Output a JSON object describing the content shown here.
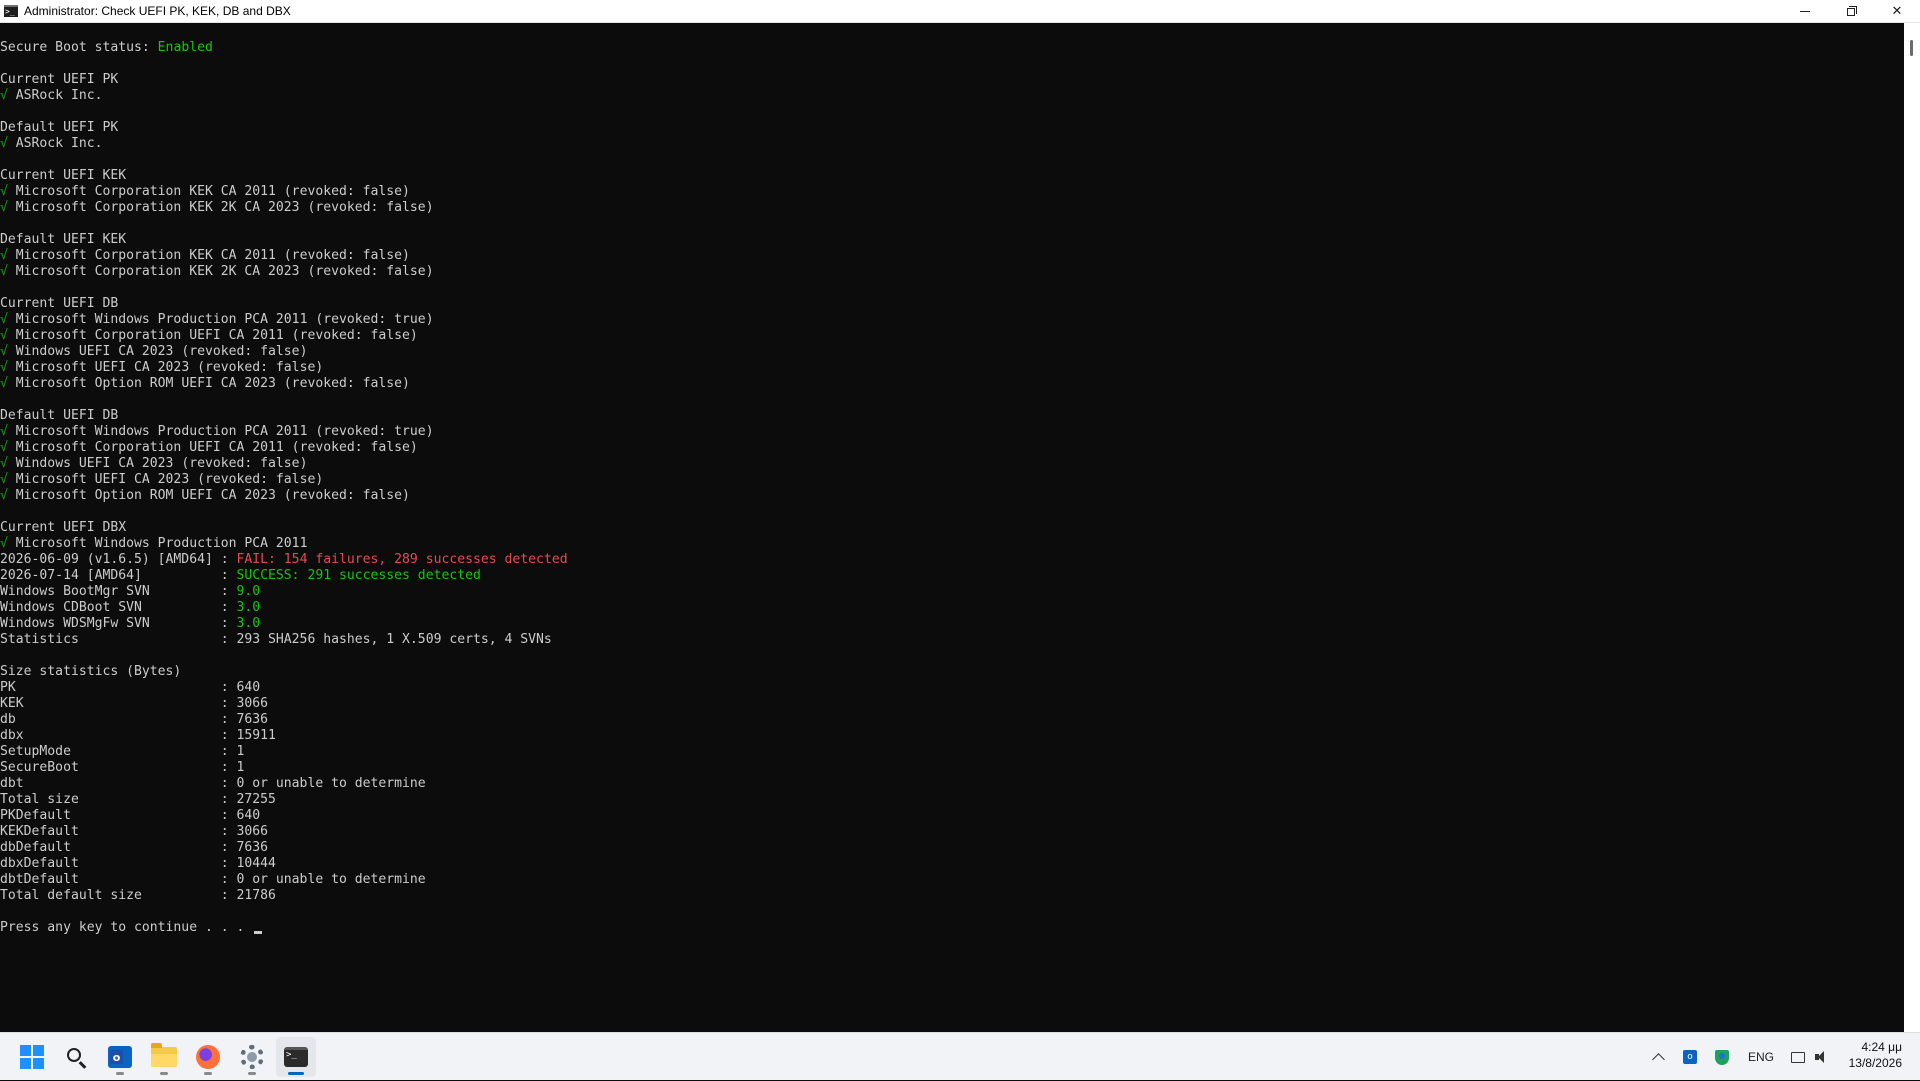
{
  "window": {
    "title": "Administrator:  Check UEFI PK, KEK, DB and DBX",
    "icon": "console-icon",
    "controls": {
      "minimize": "minimize-icon",
      "restore": "restore-icon",
      "close": "✕"
    }
  },
  "console": {
    "lines": [
      {
        "parts": [
          {
            "t": "Secure Boot status: ",
            "c": ""
          },
          {
            "t": "Enabled",
            "c": "ok"
          }
        ]
      },
      {
        "parts": []
      },
      {
        "parts": [
          {
            "t": "Current UEFI PK",
            "c": ""
          }
        ]
      },
      {
        "parts": [
          {
            "t": "√",
            "c": "check"
          },
          {
            "t": " ASRock Inc.",
            "c": ""
          }
        ]
      },
      {
        "parts": []
      },
      {
        "parts": [
          {
            "t": "Default UEFI PK",
            "c": ""
          }
        ]
      },
      {
        "parts": [
          {
            "t": "√",
            "c": "check"
          },
          {
            "t": " ASRock Inc.",
            "c": ""
          }
        ]
      },
      {
        "parts": []
      },
      {
        "parts": [
          {
            "t": "Current UEFI KEK",
            "c": ""
          }
        ]
      },
      {
        "parts": [
          {
            "t": "√",
            "c": "check"
          },
          {
            "t": " Microsoft Corporation KEK CA 2011 (revoked: false)",
            "c": ""
          }
        ]
      },
      {
        "parts": [
          {
            "t": "√",
            "c": "check"
          },
          {
            "t": " Microsoft Corporation KEK 2K CA 2023 (revoked: false)",
            "c": ""
          }
        ]
      },
      {
        "parts": []
      },
      {
        "parts": [
          {
            "t": "Default UEFI KEK",
            "c": ""
          }
        ]
      },
      {
        "parts": [
          {
            "t": "√",
            "c": "check"
          },
          {
            "t": " Microsoft Corporation KEK CA 2011 (revoked: false)",
            "c": ""
          }
        ]
      },
      {
        "parts": [
          {
            "t": "√",
            "c": "check"
          },
          {
            "t": " Microsoft Corporation KEK 2K CA 2023 (revoked: false)",
            "c": ""
          }
        ]
      },
      {
        "parts": []
      },
      {
        "parts": [
          {
            "t": "Current UEFI DB",
            "c": ""
          }
        ]
      },
      {
        "parts": [
          {
            "t": "√",
            "c": "check"
          },
          {
            "t": " Microsoft Windows Production PCA 2011 (revoked: true)",
            "c": ""
          }
        ]
      },
      {
        "parts": [
          {
            "t": "√",
            "c": "check"
          },
          {
            "t": " Microsoft Corporation UEFI CA 2011 (revoked: false)",
            "c": ""
          }
        ]
      },
      {
        "parts": [
          {
            "t": "√",
            "c": "check"
          },
          {
            "t": " Windows UEFI CA 2023 (revoked: false)",
            "c": ""
          }
        ]
      },
      {
        "parts": [
          {
            "t": "√",
            "c": "check"
          },
          {
            "t": " Microsoft UEFI CA 2023 (revoked: false)",
            "c": ""
          }
        ]
      },
      {
        "parts": [
          {
            "t": "√",
            "c": "check"
          },
          {
            "t": " Microsoft Option ROM UEFI CA 2023 (revoked: false)",
            "c": ""
          }
        ]
      },
      {
        "parts": []
      },
      {
        "parts": [
          {
            "t": "Default UEFI DB",
            "c": ""
          }
        ]
      },
      {
        "parts": [
          {
            "t": "√",
            "c": "check"
          },
          {
            "t": " Microsoft Windows Production PCA 2011 (revoked: true)",
            "c": ""
          }
        ]
      },
      {
        "parts": [
          {
            "t": "√",
            "c": "check"
          },
          {
            "t": " Microsoft Corporation UEFI CA 2011 (revoked: false)",
            "c": ""
          }
        ]
      },
      {
        "parts": [
          {
            "t": "√",
            "c": "check"
          },
          {
            "t": " Windows UEFI CA 2023 (revoked: false)",
            "c": ""
          }
        ]
      },
      {
        "parts": [
          {
            "t": "√",
            "c": "check"
          },
          {
            "t": " Microsoft UEFI CA 2023 (revoked: false)",
            "c": ""
          }
        ]
      },
      {
        "parts": [
          {
            "t": "√",
            "c": "check"
          },
          {
            "t": " Microsoft Option ROM UEFI CA 2023 (revoked: false)",
            "c": ""
          }
        ]
      },
      {
        "parts": []
      },
      {
        "parts": [
          {
            "t": "Current UEFI DBX",
            "c": ""
          }
        ]
      },
      {
        "parts": [
          {
            "t": "√",
            "c": "check"
          },
          {
            "t": " Microsoft Windows Production PCA 2011",
            "c": ""
          }
        ]
      },
      {
        "parts": [
          {
            "t": "2026-06-09 (v1.6.5) [AMD64] : ",
            "c": ""
          },
          {
            "t": "FAIL: 154 failures, 289 successes detected",
            "c": "fail"
          }
        ]
      },
      {
        "parts": [
          {
            "t": "2026-07-14 [AMD64]          : ",
            "c": ""
          },
          {
            "t": "SUCCESS: 291 successes detected",
            "c": "ok"
          }
        ]
      },
      {
        "parts": [
          {
            "t": "Windows BootMgr SVN         : ",
            "c": ""
          },
          {
            "t": "9.0",
            "c": "ok"
          }
        ]
      },
      {
        "parts": [
          {
            "t": "Windows CDBoot SVN          : ",
            "c": ""
          },
          {
            "t": "3.0",
            "c": "ok"
          }
        ]
      },
      {
        "parts": [
          {
            "t": "Windows WDSMgFw SVN         : ",
            "c": ""
          },
          {
            "t": "3.0",
            "c": "ok"
          }
        ]
      },
      {
        "parts": [
          {
            "t": "Statistics                  : 293 SHA256 hashes, 1 X.509 certs, 4 SVNs",
            "c": ""
          }
        ]
      },
      {
        "parts": []
      },
      {
        "parts": [
          {
            "t": "Size statistics (Bytes)",
            "c": ""
          }
        ]
      },
      {
        "parts": [
          {
            "t": "PK                          : 640",
            "c": ""
          }
        ]
      },
      {
        "parts": [
          {
            "t": "KEK                         : 3066",
            "c": ""
          }
        ]
      },
      {
        "parts": [
          {
            "t": "db                          : 7636",
            "c": ""
          }
        ]
      },
      {
        "parts": [
          {
            "t": "dbx                         : 15911",
            "c": ""
          }
        ]
      },
      {
        "parts": [
          {
            "t": "SetupMode                   : 1",
            "c": ""
          }
        ]
      },
      {
        "parts": [
          {
            "t": "SecureBoot                  : 1",
            "c": ""
          }
        ]
      },
      {
        "parts": [
          {
            "t": "dbt                         : 0 or unable to determine",
            "c": ""
          }
        ]
      },
      {
        "parts": [
          {
            "t": "Total size                  : 27255",
            "c": ""
          }
        ]
      },
      {
        "parts": [
          {
            "t": "PKDefault                   : 640",
            "c": ""
          }
        ]
      },
      {
        "parts": [
          {
            "t": "KEKDefault                  : 3066",
            "c": ""
          }
        ]
      },
      {
        "parts": [
          {
            "t": "dbDefault                   : 7636",
            "c": ""
          }
        ]
      },
      {
        "parts": [
          {
            "t": "dbxDefault                  : 10444",
            "c": ""
          }
        ]
      },
      {
        "parts": [
          {
            "t": "dbtDefault                  : 0 or unable to determine",
            "c": ""
          }
        ]
      },
      {
        "parts": [
          {
            "t": "Total default size          : 21786",
            "c": ""
          }
        ]
      },
      {
        "parts": []
      },
      {
        "parts": [
          {
            "t": "Press any key to continue . . . ",
            "c": ""
          }
        ],
        "cursor": true
      }
    ]
  },
  "taskbar": {
    "apps": [
      {
        "name": "start-button",
        "icon": "windows-logo-icon"
      },
      {
        "name": "search-button",
        "icon": "search-icon"
      },
      {
        "name": "outlook-app",
        "icon": "outlook-icon"
      },
      {
        "name": "file-explorer-app",
        "icon": "folder-icon"
      },
      {
        "name": "firefox-app",
        "icon": "firefox-icon"
      },
      {
        "name": "settings-app",
        "icon": "gear-icon"
      },
      {
        "name": "terminal-app",
        "icon": "terminal-icon"
      }
    ],
    "tray": {
      "language": "ENG",
      "time": "4:24 μμ",
      "date": "13/8/2026"
    }
  },
  "colors": {
    "console_bg": "#0c0c0c",
    "console_fg": "#cccccc",
    "check_green": "#13a10e",
    "success_green": "#16c60c",
    "fail_red": "#e74856",
    "taskbar_accent": "#0067c0"
  }
}
